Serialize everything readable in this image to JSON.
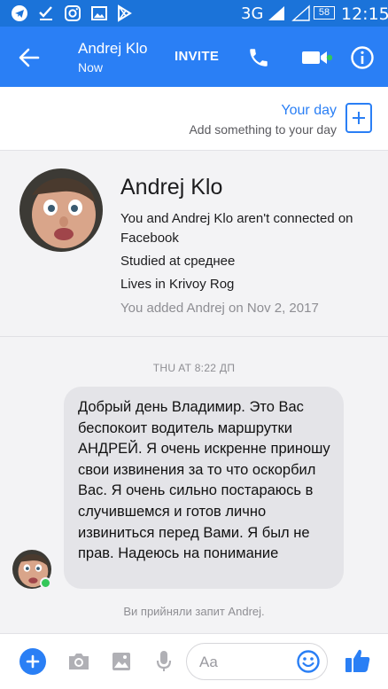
{
  "status_bar": {
    "network": "3G",
    "battery": "58",
    "time": "12:15",
    "icons": [
      "telegram-icon",
      "check-download-icon",
      "instagram-icon",
      "image-icon",
      "play-store-icon"
    ]
  },
  "header": {
    "contact_name": "Andrej Klo",
    "presence": "Now",
    "invite_label": "INVITE",
    "icons": [
      "back-arrow-icon",
      "phone-icon",
      "video-camera-icon",
      "info-icon"
    ],
    "accent": "#2a7ff5"
  },
  "your_day": {
    "title": "Your day",
    "subtitle": "Add something to your day"
  },
  "profile": {
    "name": "Andrej Klo",
    "connection": "You and Andrej Klo aren't connected on Facebook",
    "studied": "Studied at среднее",
    "lives": "Lives in Krivoy Rog",
    "added": "You added Andrej on Nov 2, 2017"
  },
  "chat": {
    "timestamp": "THU AT 8:22 ДП",
    "message": "Добрый день  Владимир. Это Вас беспокоит водитель маршрутки АНДРЕЙ. Я очень искренне приношу свои извинения за то что оскорбил Вас. Я очень сильно постараюсь в случившемся и готов лично извиниться перед Вами. Я был не прав. Надеюсь на понимание",
    "system_note": "Ви прийняли запит Andrej."
  },
  "composer": {
    "placeholder": "Aa",
    "icons": [
      "plus-icon",
      "camera-icon",
      "gallery-icon",
      "microphone-icon",
      "emoji-icon",
      "thumbs-up-icon"
    ]
  }
}
